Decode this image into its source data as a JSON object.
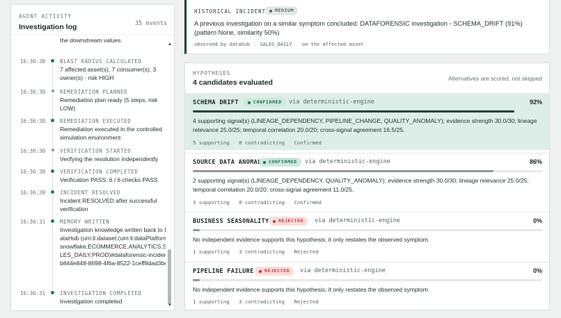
{
  "activity": {
    "eyebrow": "AGENT ACTIVITY",
    "title": "Investigation log",
    "count": "35 events",
    "cutoff_text": "the downstream values.",
    "entries": [
      {
        "time": "16:36:30",
        "name": "BLAST RADIUS CALCULATED",
        "desc": "7 affected asset(s), 7 consumer(s), 3 owner(s) - risk HIGH"
      },
      {
        "time": "16:36:30",
        "name": "REMEDIATION PLANNED",
        "desc": "Remediation plan ready (5 steps, risk LOW)"
      },
      {
        "time": "16:36:30",
        "name": "REMEDIATION EXECUTED",
        "desc": "Remediation executed in the controlled simulation environment"
      },
      {
        "time": "16:36:30",
        "name": "VERIFICATION STARTED",
        "desc": "Verifying the resolution independently"
      },
      {
        "time": "16:36:30",
        "name": "VERIFICATION COMPLETED",
        "desc": "Verification PASS: 6 / 6 checks PASS"
      },
      {
        "time": "16:36:30",
        "name": "INCIDENT RESOLVED",
        "desc": "Incident RESOLVED after successful verification"
      },
      {
        "time": "16:36:31",
        "name": "MEMORY WRITTEN",
        "desc": "Investigation knowledge written back to DataHub (urn:li:dataset:(urn:li:dataPlatform:snowflake,ECOMMERCE.ANALYTICS.SALES_DAILY,PROD)#dataforensic-incident-b844e848-8698-4f6a-8522-1ceff8dad3be)"
      },
      {
        "time": "16:36:31",
        "name": "INVESTIGATION COMPLETED",
        "desc": "Investigation completed"
      }
    ]
  },
  "historical": {
    "eyebrow": "HISTORICAL INCIDENT",
    "severity": "MEDIUM",
    "text": "A previous investigation on a similar symptom concluded: DATAFORENSIC investigation - SCHEMA_DRIFT (91%) (pattern None, similarity 50%)",
    "meta_source": "observed by datahub",
    "meta_asset": "SALES_DAILY",
    "meta_scope": "on the affected asset"
  },
  "hypotheses": {
    "eyebrow": "HYPOTHESES",
    "title": "4 candidates evaluated",
    "note": "Alternatives are scored, not skipped",
    "items": [
      {
        "name": "SCHEMA DRIFT",
        "status": "CONFIRMED",
        "via": "via deterministic-engine",
        "pct": "92%",
        "score": 92,
        "desc": "4 supporting signal(s) (LINEAGE_DEPENDENCY, PIPELINE_CHANGE, QUALITY_ANOMALY); evidence strength 30.0/30; lineage relevance 25.0/25; temporal correlation 20.0/20; cross-signal agreement 16.5/25.",
        "supporting": "5 supporting",
        "contradicting": "0 contradicting",
        "verdict": "Confirmed"
      },
      {
        "name": "SOURCE DATA ANOMALY",
        "status": "CONFIRMED",
        "via": "via deterministic-engine",
        "pct": "86%",
        "score": 86,
        "desc": "2 supporting signal(s) (LINEAGE_DEPENDENCY, QUALITY_ANOMALY); evidence strength 30.0/30; lineage relevance 25.0/25; temporal correlation 20.0/20; cross-signal agreement 11.0/25.",
        "supporting": "3 supporting",
        "contradicting": "0 contradicting",
        "verdict": "Confirmed"
      },
      {
        "name": "BUSINESS SEASONALITY",
        "status": "REJECTED",
        "via": "via deterministic-engine",
        "pct": "0%",
        "score": 0,
        "desc": "No independent evidence supports this hypothesis; it only restates the observed symptom.",
        "supporting": "1 supporting",
        "contradicting": "3 contradicting",
        "verdict": "Rejected"
      },
      {
        "name": "PIPELINE FAILURE",
        "status": "REJECTED",
        "via": "via deterministic-engine",
        "pct": "0%",
        "score": 0,
        "desc": "No independent evidence supports this hypothesis; it only restates the observed symptom.",
        "supporting": "1 supporting",
        "contradicting": "3 contradicting",
        "verdict": "Rejected"
      }
    ]
  },
  "colors": {
    "confirmed": "#1a7a57",
    "rejected": "#b23a3a",
    "accent": "#1c3b33"
  }
}
